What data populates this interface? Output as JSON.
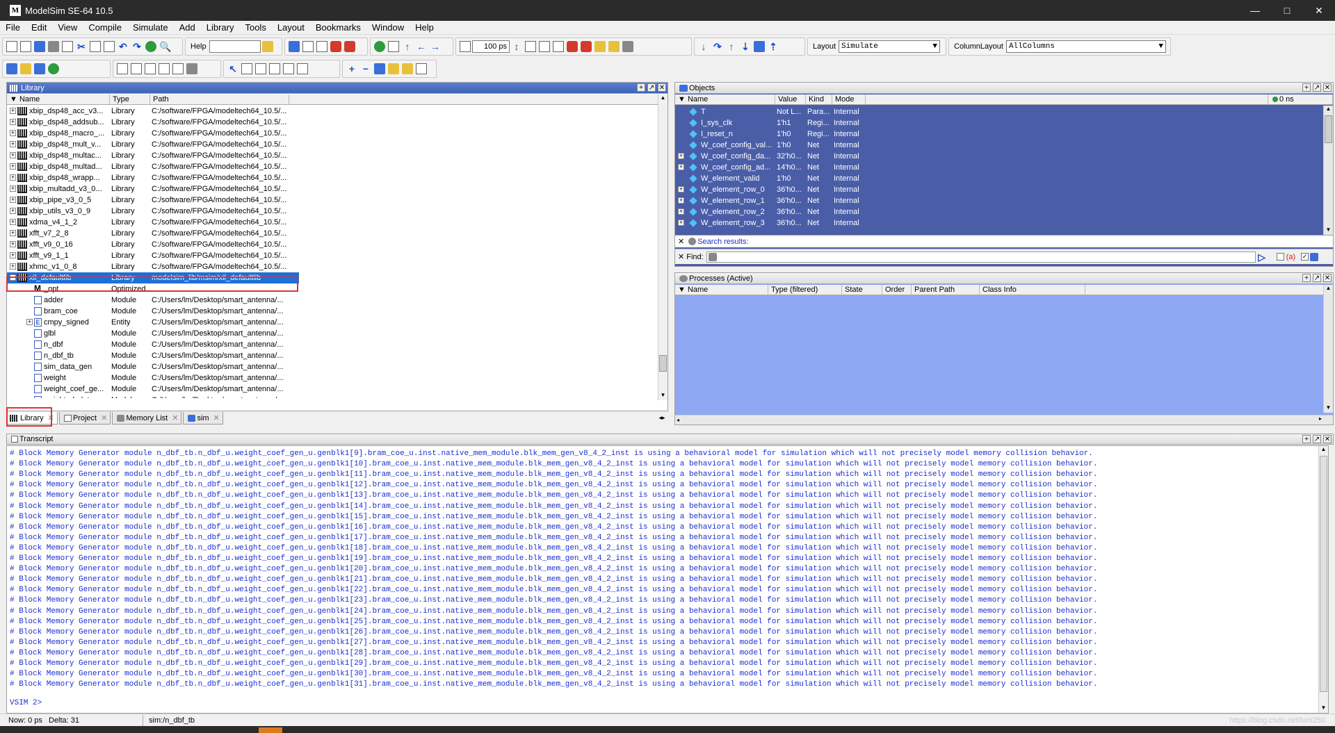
{
  "window": {
    "title": "ModelSim SE-64 10.5",
    "app_icon": "M"
  },
  "menu": [
    "File",
    "Edit",
    "View",
    "Compile",
    "Simulate",
    "Add",
    "Library",
    "Tools",
    "Layout",
    "Bookmarks",
    "Window",
    "Help"
  ],
  "toolbar": {
    "help_label": "Help",
    "help_value": "",
    "run_length": "100 ps",
    "layout_label": "Layout",
    "layout_value": "Simulate",
    "columnlayout_label": "ColumnLayout",
    "columnlayout_value": "AllColumns"
  },
  "library": {
    "title": "Library",
    "columns": [
      "Name",
      "Type",
      "Path"
    ],
    "rows": [
      {
        "name": "xbip_dsp48_acc_v3...",
        "type": "Library",
        "path": "C:/software/FPGA/modeltech64_10.5/...",
        "kind": "lib",
        "exp": "+"
      },
      {
        "name": "xbip_dsp48_addsub...",
        "type": "Library",
        "path": "C:/software/FPGA/modeltech64_10.5/...",
        "kind": "lib",
        "exp": "+"
      },
      {
        "name": "xbip_dsp48_macro_...",
        "type": "Library",
        "path": "C:/software/FPGA/modeltech64_10.5/...",
        "kind": "lib",
        "exp": "+"
      },
      {
        "name": "xbip_dsp48_mult_v...",
        "type": "Library",
        "path": "C:/software/FPGA/modeltech64_10.5/...",
        "kind": "lib",
        "exp": "+"
      },
      {
        "name": "xbip_dsp48_multac...",
        "type": "Library",
        "path": "C:/software/FPGA/modeltech64_10.5/...",
        "kind": "lib",
        "exp": "+"
      },
      {
        "name": "xbip_dsp48_multad...",
        "type": "Library",
        "path": "C:/software/FPGA/modeltech64_10.5/...",
        "kind": "lib",
        "exp": "+"
      },
      {
        "name": "xbip_dsp48_wrapp...",
        "type": "Library",
        "path": "C:/software/FPGA/modeltech64_10.5/...",
        "kind": "lib",
        "exp": "+"
      },
      {
        "name": "xbip_multadd_v3_0...",
        "type": "Library",
        "path": "C:/software/FPGA/modeltech64_10.5/...",
        "kind": "lib",
        "exp": "+"
      },
      {
        "name": "xbip_pipe_v3_0_5",
        "type": "Library",
        "path": "C:/software/FPGA/modeltech64_10.5/...",
        "kind": "lib",
        "exp": "+"
      },
      {
        "name": "xbip_utils_v3_0_9",
        "type": "Library",
        "path": "C:/software/FPGA/modeltech64_10.5/...",
        "kind": "lib",
        "exp": "+"
      },
      {
        "name": "xdma_v4_1_2",
        "type": "Library",
        "path": "C:/software/FPGA/modeltech64_10.5/...",
        "kind": "lib",
        "exp": "+"
      },
      {
        "name": "xfft_v7_2_8",
        "type": "Library",
        "path": "C:/software/FPGA/modeltech64_10.5/...",
        "kind": "lib",
        "exp": "+"
      },
      {
        "name": "xfft_v9_0_16",
        "type": "Library",
        "path": "C:/software/FPGA/modeltech64_10.5/...",
        "kind": "lib",
        "exp": "+"
      },
      {
        "name": "xfft_v9_1_1",
        "type": "Library",
        "path": "C:/software/FPGA/modeltech64_10.5/...",
        "kind": "lib",
        "exp": "+"
      },
      {
        "name": "xhmc_v1_0_8",
        "type": "Library",
        "path": "C:/software/FPGA/modeltech64_10.5/...",
        "kind": "lib",
        "exp": "+"
      },
      {
        "name": "xil_defaultlib",
        "type": "Library",
        "path": "modelsim_lib/msim/xil_defaultlib",
        "kind": "lib",
        "exp": "-",
        "selected": true
      },
      {
        "name": "_opt",
        "type": "Optimized...",
        "path": "",
        "kind": "opt",
        "exp": ""
      },
      {
        "name": "adder",
        "type": "Module",
        "path": "C:/Users/lm/Desktop/smart_antenna/...",
        "kind": "mod",
        "exp": ""
      },
      {
        "name": "bram_coe",
        "type": "Module",
        "path": "C:/Users/lm/Desktop/smart_antenna/...",
        "kind": "mod",
        "exp": ""
      },
      {
        "name": "cmpy_signed",
        "type": "Entity",
        "path": "C:/Users/lm/Desktop/smart_antenna/...",
        "kind": "ent",
        "exp": "+"
      },
      {
        "name": "glbl",
        "type": "Module",
        "path": "C:/Users/lm/Desktop/smart_antenna/...",
        "kind": "mod",
        "exp": ""
      },
      {
        "name": "n_dbf",
        "type": "Module",
        "path": "C:/Users/lm/Desktop/smart_antenna/...",
        "kind": "mod",
        "exp": ""
      },
      {
        "name": "n_dbf_tb",
        "type": "Module",
        "path": "C:/Users/lm/Desktop/smart_antenna/...",
        "kind": "mod",
        "exp": ""
      },
      {
        "name": "sim_data_gen",
        "type": "Module",
        "path": "C:/Users/lm/Desktop/smart_antenna/...",
        "kind": "mod",
        "exp": ""
      },
      {
        "name": "weight",
        "type": "Module",
        "path": "C:/Users/lm/Desktop/smart_antenna/...",
        "kind": "mod",
        "exp": ""
      },
      {
        "name": "weight_coef_ge...",
        "type": "Module",
        "path": "C:/Users/lm/Desktop/smart_antenna/...",
        "kind": "mod",
        "exp": ""
      },
      {
        "name": "weighted_data_...",
        "type": "Module",
        "path": "C:/Users/lm/Desktop/smart_antenna/...",
        "kind": "mod",
        "exp": ""
      }
    ],
    "tabs": [
      "Library",
      "Project",
      "Memory List",
      "sim"
    ]
  },
  "objects": {
    "title": "Objects",
    "time": "0 ns",
    "columns": [
      "Name",
      "Value",
      "Kind",
      "Mode"
    ],
    "rows": [
      {
        "name": "T",
        "value": "Not L...",
        "kind": "Para...",
        "mode": "Internal",
        "exp": ""
      },
      {
        "name": "I_sys_clk",
        "value": "1'h1",
        "kind": "Regi...",
        "mode": "Internal",
        "exp": ""
      },
      {
        "name": "I_reset_n",
        "value": "1'h0",
        "kind": "Regi...",
        "mode": "Internal",
        "exp": ""
      },
      {
        "name": "W_coef_config_val...",
        "value": "1'h0",
        "kind": "Net",
        "mode": "Internal",
        "exp": ""
      },
      {
        "name": "W_coef_config_da...",
        "value": "32'h0...",
        "kind": "Net",
        "mode": "Internal",
        "exp": "+"
      },
      {
        "name": "W_coef_config_ad...",
        "value": "14'h0...",
        "kind": "Net",
        "mode": "Internal",
        "exp": "+"
      },
      {
        "name": "W_element_valid",
        "value": "1'h0",
        "kind": "Net",
        "mode": "Internal",
        "exp": ""
      },
      {
        "name": "W_element_row_0",
        "value": "36'h0...",
        "kind": "Net",
        "mode": "Internal",
        "exp": "+"
      },
      {
        "name": "W_element_row_1",
        "value": "36'h0...",
        "kind": "Net",
        "mode": "Internal",
        "exp": "+"
      },
      {
        "name": "W_element_row_2",
        "value": "36'h0...",
        "kind": "Net",
        "mode": "Internal",
        "exp": "+"
      },
      {
        "name": "W_element_row_3",
        "value": "36'h0...",
        "kind": "Net",
        "mode": "Internal",
        "exp": "+"
      }
    ],
    "search_results": "Search results:",
    "find_label": "Find:"
  },
  "processes": {
    "title": "Processes (Active)",
    "columns": [
      "Name",
      "Type (filtered)",
      "State",
      "Order",
      "Parent Path",
      "Class Info"
    ]
  },
  "transcript": {
    "title": "Transcript",
    "lines": [
      "# Block Memory Generator module n_dbf_tb.n_dbf_u.weight_coef_gen_u.genblk1[9].bram_coe_u.inst.native_mem_module.blk_mem_gen_v8_4_2_inst is using a behavioral model for simulation which will not precisely model memory collision behavior.",
      "# Block Memory Generator module n_dbf_tb.n_dbf_u.weight_coef_gen_u.genblk1[10].bram_coe_u.inst.native_mem_module.blk_mem_gen_v8_4_2_inst is using a behavioral model for simulation which will not precisely model memory collision behavior.",
      "# Block Memory Generator module n_dbf_tb.n_dbf_u.weight_coef_gen_u.genblk1[11].bram_coe_u.inst.native_mem_module.blk_mem_gen_v8_4_2_inst is using a behavioral model for simulation which will not precisely model memory collision behavior.",
      "# Block Memory Generator module n_dbf_tb.n_dbf_u.weight_coef_gen_u.genblk1[12].bram_coe_u.inst.native_mem_module.blk_mem_gen_v8_4_2_inst is using a behavioral model for simulation which will not precisely model memory collision behavior.",
      "# Block Memory Generator module n_dbf_tb.n_dbf_u.weight_coef_gen_u.genblk1[13].bram_coe_u.inst.native_mem_module.blk_mem_gen_v8_4_2_inst is using a behavioral model for simulation which will not precisely model memory collision behavior.",
      "# Block Memory Generator module n_dbf_tb.n_dbf_u.weight_coef_gen_u.genblk1[14].bram_coe_u.inst.native_mem_module.blk_mem_gen_v8_4_2_inst is using a behavioral model for simulation which will not precisely model memory collision behavior.",
      "# Block Memory Generator module n_dbf_tb.n_dbf_u.weight_coef_gen_u.genblk1[15].bram_coe_u.inst.native_mem_module.blk_mem_gen_v8_4_2_inst is using a behavioral model for simulation which will not precisely model memory collision behavior.",
      "# Block Memory Generator module n_dbf_tb.n_dbf_u.weight_coef_gen_u.genblk1[16].bram_coe_u.inst.native_mem_module.blk_mem_gen_v8_4_2_inst is using a behavioral model for simulation which will not precisely model memory collision behavior.",
      "# Block Memory Generator module n_dbf_tb.n_dbf_u.weight_coef_gen_u.genblk1[17].bram_coe_u.inst.native_mem_module.blk_mem_gen_v8_4_2_inst is using a behavioral model for simulation which will not precisely model memory collision behavior.",
      "# Block Memory Generator module n_dbf_tb.n_dbf_u.weight_coef_gen_u.genblk1[18].bram_coe_u.inst.native_mem_module.blk_mem_gen_v8_4_2_inst is using a behavioral model for simulation which will not precisely model memory collision behavior.",
      "# Block Memory Generator module n_dbf_tb.n_dbf_u.weight_coef_gen_u.genblk1[19].bram_coe_u.inst.native_mem_module.blk_mem_gen_v8_4_2_inst is using a behavioral model for simulation which will not precisely model memory collision behavior.",
      "# Block Memory Generator module n_dbf_tb.n_dbf_u.weight_coef_gen_u.genblk1[20].bram_coe_u.inst.native_mem_module.blk_mem_gen_v8_4_2_inst is using a behavioral model for simulation which will not precisely model memory collision behavior.",
      "# Block Memory Generator module n_dbf_tb.n_dbf_u.weight_coef_gen_u.genblk1[21].bram_coe_u.inst.native_mem_module.blk_mem_gen_v8_4_2_inst is using a behavioral model for simulation which will not precisely model memory collision behavior.",
      "# Block Memory Generator module n_dbf_tb.n_dbf_u.weight_coef_gen_u.genblk1[22].bram_coe_u.inst.native_mem_module.blk_mem_gen_v8_4_2_inst is using a behavioral model for simulation which will not precisely model memory collision behavior.",
      "# Block Memory Generator module n_dbf_tb.n_dbf_u.weight_coef_gen_u.genblk1[23].bram_coe_u.inst.native_mem_module.blk_mem_gen_v8_4_2_inst is using a behavioral model for simulation which will not precisely model memory collision behavior.",
      "# Block Memory Generator module n_dbf_tb.n_dbf_u.weight_coef_gen_u.genblk1[24].bram_coe_u.inst.native_mem_module.blk_mem_gen_v8_4_2_inst is using a behavioral model for simulation which will not precisely model memory collision behavior.",
      "# Block Memory Generator module n_dbf_tb.n_dbf_u.weight_coef_gen_u.genblk1[25].bram_coe_u.inst.native_mem_module.blk_mem_gen_v8_4_2_inst is using a behavioral model for simulation which will not precisely model memory collision behavior.",
      "# Block Memory Generator module n_dbf_tb.n_dbf_u.weight_coef_gen_u.genblk1[26].bram_coe_u.inst.native_mem_module.blk_mem_gen_v8_4_2_inst is using a behavioral model for simulation which will not precisely model memory collision behavior.",
      "# Block Memory Generator module n_dbf_tb.n_dbf_u.weight_coef_gen_u.genblk1[27].bram_coe_u.inst.native_mem_module.blk_mem_gen_v8_4_2_inst is using a behavioral model for simulation which will not precisely model memory collision behavior.",
      "# Block Memory Generator module n_dbf_tb.n_dbf_u.weight_coef_gen_u.genblk1[28].bram_coe_u.inst.native_mem_module.blk_mem_gen_v8_4_2_inst is using a behavioral model for simulation which will not precisely model memory collision behavior.",
      "# Block Memory Generator module n_dbf_tb.n_dbf_u.weight_coef_gen_u.genblk1[29].bram_coe_u.inst.native_mem_module.blk_mem_gen_v8_4_2_inst is using a behavioral model for simulation which will not precisely model memory collision behavior.",
      "# Block Memory Generator module n_dbf_tb.n_dbf_u.weight_coef_gen_u.genblk1[30].bram_coe_u.inst.native_mem_module.blk_mem_gen_v8_4_2_inst is using a behavioral model for simulation which will not precisely model memory collision behavior.",
      "# Block Memory Generator module n_dbf_tb.n_dbf_u.weight_coef_gen_u.genblk1[31].bram_coe_u.inst.native_mem_module.blk_mem_gen_v8_4_2_inst is using a behavioral model for simulation which will not precisely model memory collision behavior."
    ],
    "prompt": "VSIM 2>"
  },
  "status": {
    "now": "Now: 0 ps",
    "delta": "Delta: 31",
    "context": "sim:/n_dbf_tb",
    "watermark": "https://blog.csdn.net/lum250"
  },
  "colors": {
    "objects_bg": "#4a5ea8",
    "processes_bg": "#8ea8f4",
    "selected_row": "#1e6fd8",
    "transcript_text": "#1a2fd0",
    "highlight_box": "#e03030"
  }
}
